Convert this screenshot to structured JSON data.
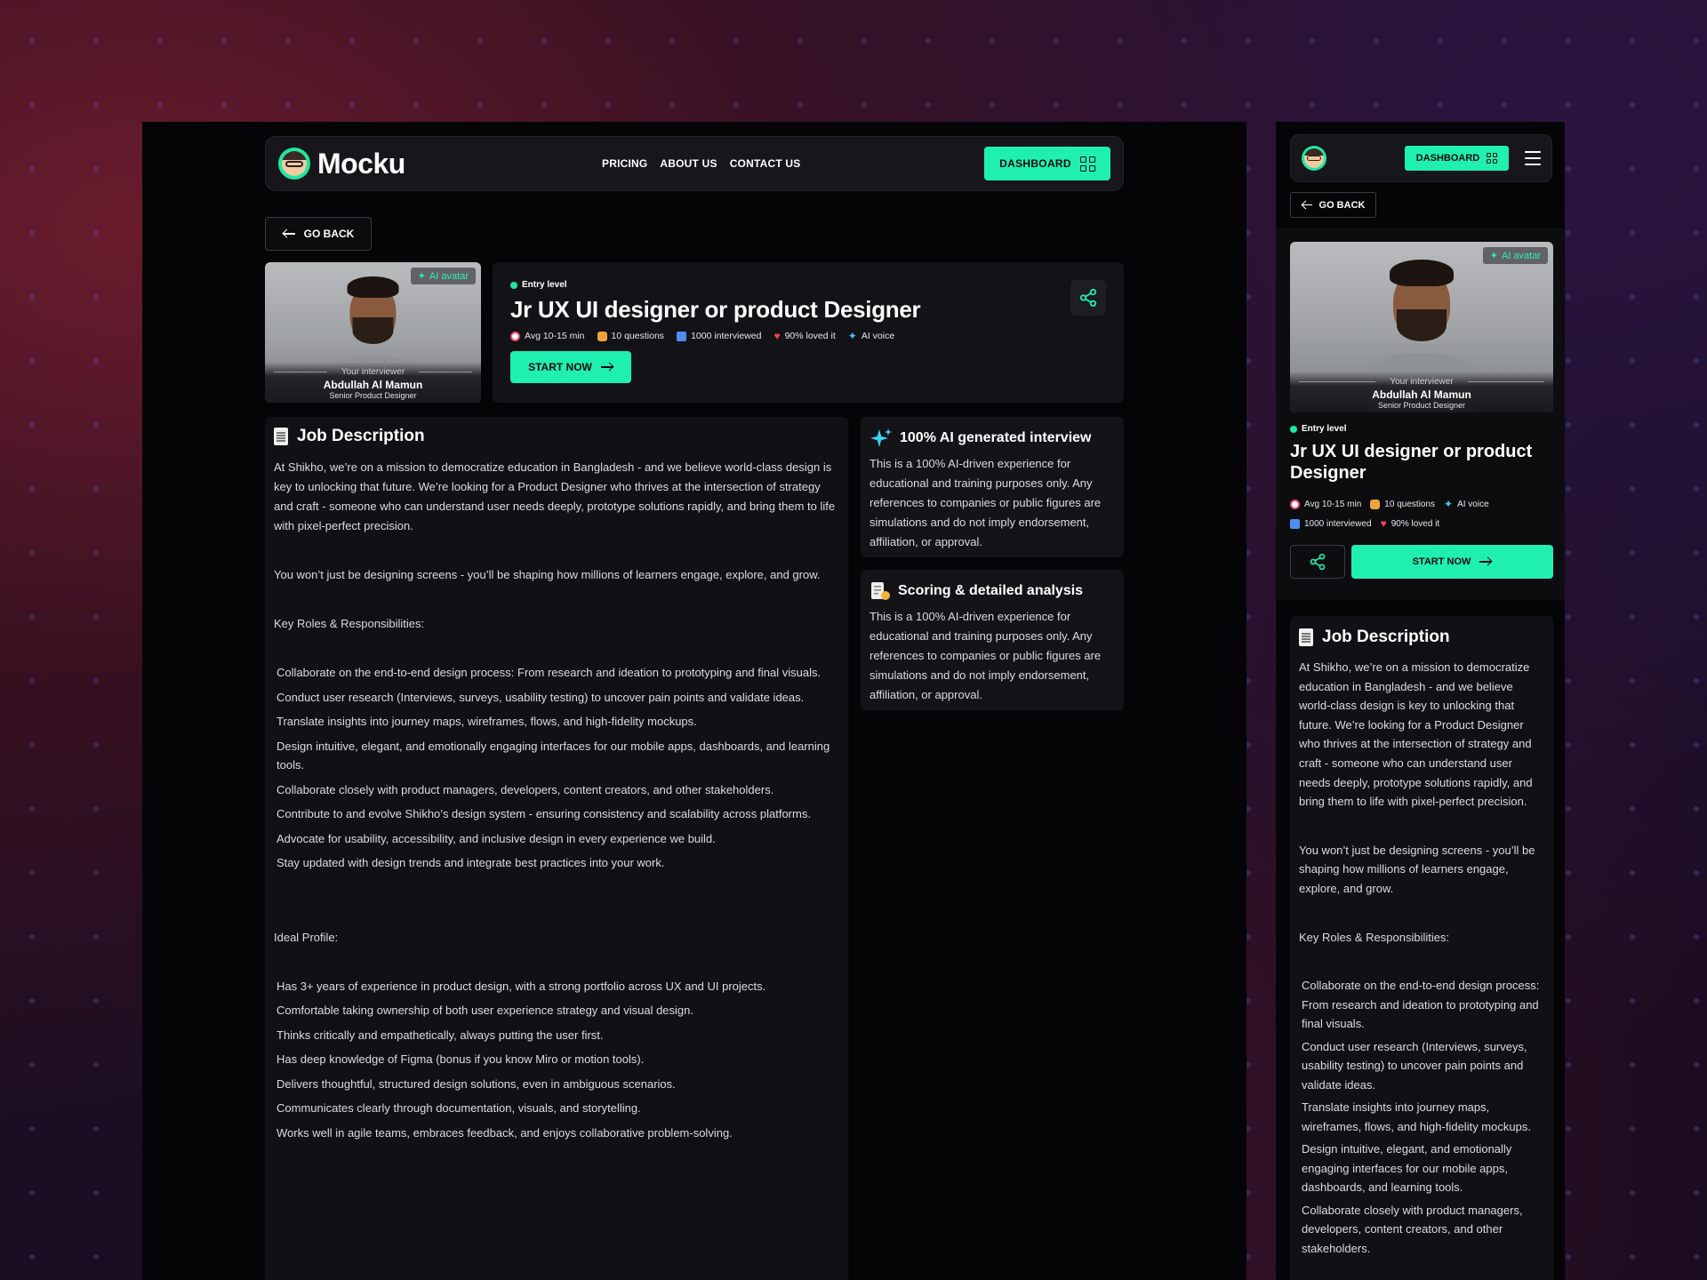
{
  "nav": {
    "logo": "Mocku",
    "links": [
      "PRICING",
      "ABOUT US",
      "CONTACT US"
    ],
    "dashboard": "DASHBOARD"
  },
  "go_back": "GO BACK",
  "interviewer": {
    "badge": "AI avatar",
    "label": "Your interviewer",
    "name": "Abdullah Al Mamun",
    "role": "Senior Product Designer"
  },
  "job": {
    "level": "Entry level",
    "title": "Jr UX UI designer or product Designer",
    "meta": {
      "duration": "Avg 10-15 min",
      "questions": "10 questions",
      "interviewed": "1000 interviewed",
      "loved": "90% loved it",
      "voice": "AI voice"
    },
    "start": "START NOW"
  },
  "description": {
    "heading": "Job Description",
    "intro": "At Shikho, we’re on a mission to democratize education in Bangladesh - and we believe world-class design is key to unlocking that future. We’re looking for a Product Designer who thrives at the intersection of strategy and craft - someone who can understand user needs deeply, prototype solutions rapidly, and bring them to life with pixel-perfect precision.",
    "intro2": "You won’t just be designing screens - you’ll be shaping how millions of learners engage, explore, and grow.",
    "roles_heading": "Key Roles & Responsibilities:",
    "roles": [
      "Collaborate on the end-to-end design process: From research and ideation to prototyping and final visuals.",
      "Conduct user research (Interviews, surveys, usability testing) to uncover pain points and validate ideas.",
      "Translate insights into journey maps, wireframes, flows, and high-fidelity mockups.",
      "Design intuitive, elegant, and emotionally engaging interfaces for our mobile apps, dashboards, and learning tools.",
      "Collaborate closely with product managers, developers, content creators, and other stakeholders.",
      "Contribute to and evolve Shikho’s design system - ensuring consistency and scalability across platforms.",
      "Advocate for usability, accessibility, and inclusive design in every experience we build.",
      "Stay updated with design trends and integrate best practices into your work."
    ],
    "profile_heading": "Ideal Profile:",
    "profile": [
      "Has 3+ years of experience in product design, with a strong portfolio across UX and UI projects.",
      "Comfortable taking ownership of both user experience strategy and visual design.",
      "Thinks critically and empathetically, always putting the user first.",
      "Has deep knowledge of Figma (bonus if you know Miro or motion tools).",
      "Delivers thoughtful, structured design solutions, even in ambiguous scenarios.",
      "Communicates clearly through documentation, visuals, and storytelling.",
      "Works well in agile teams, embraces feedback, and enjoys collaborative problem-solving."
    ]
  },
  "cards": {
    "ai": {
      "title": "100% AI generated interview",
      "text": "This is a 100% AI-driven experience for educational and training purposes only. Any references to companies or public figures are simulations and do not imply endorsement, affiliation, or approval."
    },
    "scoring": {
      "title": "Scoring & detailed analysis",
      "text": "This is a 100% AI-driven experience for educational and training purposes only. Any references to companies or public figures are simulations and do not imply endorsement, affiliation, or approval."
    }
  },
  "colors": {
    "accent": "#1ff0b0",
    "background": "#050507",
    "panel": "#111115"
  }
}
